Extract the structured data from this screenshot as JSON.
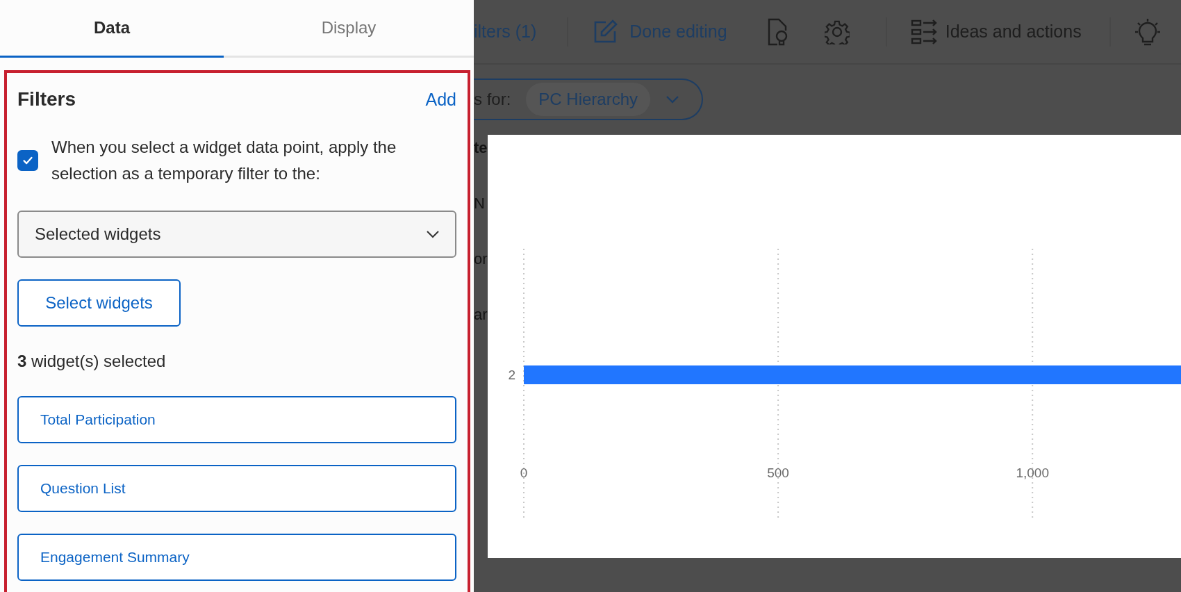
{
  "panel": {
    "tabs": [
      {
        "label": "Data",
        "selected": true
      },
      {
        "label": "Display",
        "selected": false
      }
    ],
    "section_title": "Filters",
    "add_link": "Add",
    "temporary_filter": {
      "checked": true,
      "label": "When you select a widget data point, apply the selection as a temporary filter to the:"
    },
    "target_dropdown": {
      "value": "Selected widgets"
    },
    "select_button": "Select widgets",
    "selected_count": "**3** widget(s) selected",
    "selected_widgets": [
      "Total Participation",
      "Question List",
      "Engagement Summary"
    ]
  },
  "toolbar": {
    "items": [
      {
        "kind": "text",
        "label": "ilters (1)"
      },
      {
        "kind": "divider"
      },
      {
        "kind": "edit",
        "label": "Done editing"
      },
      {
        "kind": "insight"
      },
      {
        "kind": "settings"
      },
      {
        "kind": "divider"
      },
      {
        "kind": "ideas",
        "label": "Ideas and actions"
      },
      {
        "kind": "divider"
      },
      {
        "kind": "bulb"
      }
    ]
  },
  "filter_bar": {
    "label": "s for:",
    "chip": "PC Hierarchy"
  },
  "background_fragments": [
    "te",
    "N",
    "or",
    "ar"
  ],
  "chart_data": {
    "type": "bar",
    "orientation": "horizontal",
    "categories": [
      "2"
    ],
    "values": [
      1292
    ],
    "xlim": [
      0,
      1292
    ],
    "xticks": [
      0,
      {
        "value": 500,
        "label": "500"
      },
      {
        "value": 1000,
        "label": "1,000"
      }
    ]
  }
}
